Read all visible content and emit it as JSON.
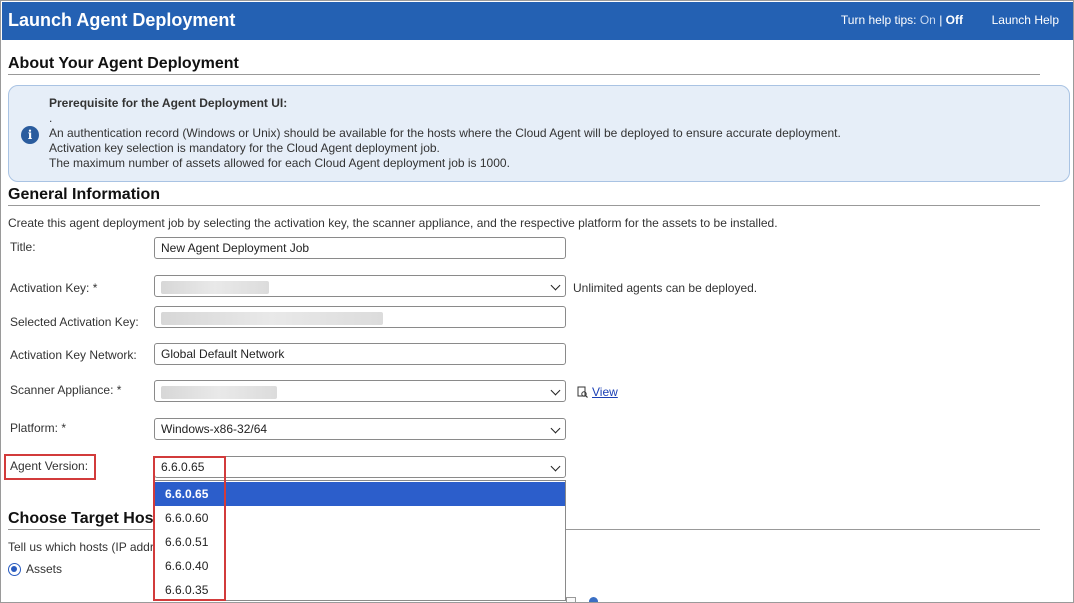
{
  "header": {
    "title": "Launch Agent Deployment",
    "help_tips_label": "Turn help tips:",
    "help_tips_on": "On",
    "help_tips_sep": "|",
    "help_tips_off": "Off",
    "launch_help": "Launch Help"
  },
  "about": {
    "section_title": "About Your Agent Deployment",
    "heading": "Prerequisite for the Agent Deployment UI:",
    "dot": ".",
    "lines": [
      "An authentication record (Windows or Unix) should be available for the hosts where the Cloud Agent will be deployed to ensure accurate deployment.",
      "Activation key selection is mandatory for the Cloud Agent deployment job.",
      "The maximum number of assets allowed for each Cloud Agent deployment job is 1000."
    ]
  },
  "general": {
    "section_title": "General Information",
    "description": "Create this agent deployment job by selecting the activation key, the scanner appliance, and the respective platform for the assets to be installed.",
    "title_label": "Title:",
    "title_value": "New Agent Deployment Job",
    "activation_key_label": "Activation Key: *",
    "activation_key_note": "Unlimited agents can be deployed.",
    "selected_key_label": "Selected Activation Key:",
    "network_label": "Activation Key Network:",
    "network_value": "Global Default Network",
    "scanner_label": "Scanner Appliance: *",
    "view_link": "View",
    "platform_label": "Platform: *",
    "platform_value": "Windows-x86-32/64",
    "agent_version_label": "Agent Version:",
    "agent_version_value": "6.6.0.65",
    "agent_version_options": [
      "6.6.0.65",
      "6.6.0.60",
      "6.6.0.51",
      "6.6.0.40",
      "6.6.0.35"
    ]
  },
  "targets": {
    "section_title": "Choose Target Hos",
    "prompt": "Tell us which hosts (IP addr",
    "assets_label": "Assets"
  }
}
